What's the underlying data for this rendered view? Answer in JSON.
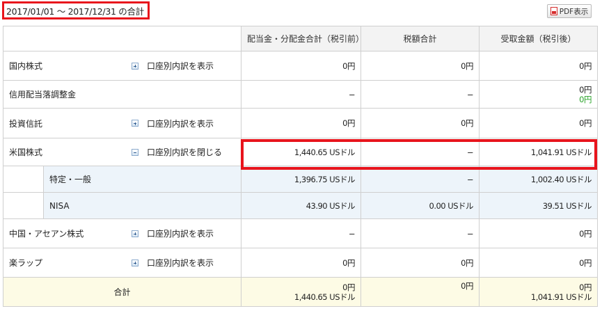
{
  "header": {
    "period": "2017/01/01 ～ 2017/12/31 の合計",
    "pdf_label": "PDF表示"
  },
  "columns": {
    "gross": "配当金・分配金合計（税引前）",
    "tax": "税額合計",
    "net": "受取金額（税引後）"
  },
  "rows": {
    "domestic": {
      "name": "国内株式",
      "toggle": "口座別内訳を表示",
      "gross": "0円",
      "tax": "0円",
      "net": "0円"
    },
    "margin": {
      "name": "信用配当落調整金",
      "gross": "−",
      "tax": "−",
      "net": "0円",
      "net2": "0円"
    },
    "fund": {
      "name": "投資信託",
      "toggle": "口座別内訳を表示",
      "gross": "0円",
      "tax": "0円",
      "net": "0円"
    },
    "us": {
      "name": "米国株式",
      "toggle": "口座別内訳を閉じる",
      "gross": "1,440.65 USドル",
      "tax": "−",
      "net": "1,041.91 USドル"
    },
    "us_specific": {
      "name": "特定・一般",
      "gross": "1,396.75 USドル",
      "tax": "−",
      "net": "1,002.40 USドル"
    },
    "us_nisa": {
      "name": "NISA",
      "gross": "43.90 USドル",
      "tax": "0.00 USドル",
      "net": "39.51 USドル"
    },
    "china": {
      "name": "中国・アセアン株式",
      "toggle": "口座別内訳を表示",
      "gross": "−",
      "tax": "−",
      "net": "0円"
    },
    "wrap": {
      "name": "楽ラップ",
      "toggle": "口座別内訳を表示",
      "gross": "0円",
      "tax": "0円",
      "net": "0円"
    },
    "total": {
      "name": "合計",
      "gross": "0円",
      "gross2": "1,440.65 USドル",
      "tax": "0円",
      "net": "0円",
      "net2": "1,041.91 USドル"
    }
  },
  "colors": {
    "highlight": "#e8141c",
    "positive": "#2aa32a",
    "total_bg": "#fdfbe5",
    "sub_bg": "#edf4fa"
  }
}
